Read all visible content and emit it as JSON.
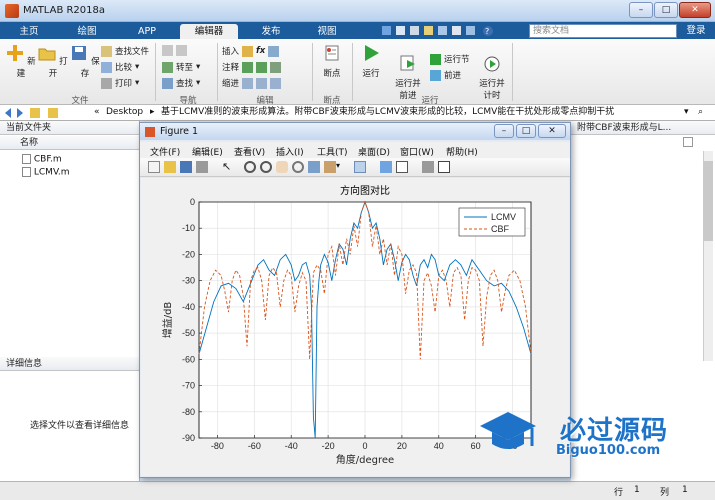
{
  "window": {
    "title": "MATLAB R2018a"
  },
  "tabs": [
    "主页",
    "绘图",
    "APP",
    "编辑器",
    "发布",
    "视图"
  ],
  "active_tab": "编辑器",
  "search": {
    "placeholder": "搜索文档"
  },
  "login_label": "登录",
  "ribbon": {
    "file": {
      "new": "新建",
      "open": "打开",
      "save": "保存",
      "find_files": "查找文件",
      "compare": "比较",
      "print": "打印",
      "group": "文件"
    },
    "navigate": {
      "goto": "转至",
      "find": "查找",
      "group": "导航"
    },
    "edit": {
      "insert": "插入",
      "comment": "注释",
      "indent": "缩进",
      "group": "编辑"
    },
    "breakpoints": {
      "label": "断点",
      "group": "断点"
    },
    "run": {
      "run": "运行",
      "run_advance": "运行并\n前进",
      "run_section": "运行节",
      "advance": "前进",
      "run_time": "运行并\n计时",
      "group": "运行"
    }
  },
  "address": {
    "path_prefix": "«",
    "path1": "Desktop",
    "path2": "基于LCMV准则的波束形成算法。附带CBF波束形成与LCMV波束形成的比较，LCMV能在干扰处形成零点抑制干扰"
  },
  "left_panel": {
    "title": "当前文件夹",
    "col_header": "名称",
    "files": [
      "CBF.m",
      "LCMV.m"
    ],
    "details_title": "详细信息",
    "details_hint": "选择文件以查看详细信息"
  },
  "right_panel": {
    "title": "附带CBF波束形成与L..."
  },
  "status": {
    "row_label": "行",
    "row": "1",
    "col_label": "列",
    "col": "1"
  },
  "figure": {
    "title": "Figure 1",
    "menu": [
      "文件(F)",
      "编辑(E)",
      "查看(V)",
      "插入(I)",
      "工具(T)",
      "桌面(D)",
      "窗口(W)",
      "帮助(H)"
    ]
  },
  "watermark": {
    "brand": "必过源码",
    "url": "Biguo100.com"
  },
  "chart_data": {
    "type": "line",
    "title": "方向图对比",
    "xlabel": "角度/degree",
    "ylabel": "增益/dB",
    "xlim": [
      -90,
      90
    ],
    "ylim": [
      -90,
      0
    ],
    "xticks": [
      -80,
      -60,
      -40,
      -20,
      0,
      20,
      40,
      60,
      80
    ],
    "yticks": [
      0,
      -10,
      -20,
      -30,
      -40,
      -50,
      -60,
      -70,
      -80,
      -90
    ],
    "grid": true,
    "legend_position": "top-right",
    "series": [
      {
        "name": "LCMV",
        "color": "#0072bd",
        "style": "solid",
        "x": [
          -90,
          -86,
          -82,
          -78,
          -74,
          -70,
          -66,
          -62,
          -58,
          -55,
          -52,
          -49,
          -46,
          -43,
          -40,
          -38,
          -36,
          -34,
          -32,
          -30,
          -29,
          -28,
          -27,
          -26,
          -25,
          -24,
          -22,
          -20,
          -18,
          -16,
          -14,
          -12,
          -10,
          -8,
          -6,
          -4,
          -2,
          0,
          2,
          4,
          6,
          8,
          10,
          12,
          14,
          16,
          18,
          20,
          22,
          24,
          26,
          28,
          30,
          32,
          34,
          36,
          38,
          40,
          43,
          46,
          49,
          52,
          55,
          58,
          62,
          66,
          70,
          74,
          78,
          82,
          86,
          90
        ],
        "y": [
          -58,
          -48,
          -38,
          -32,
          -31,
          -33,
          -38,
          -31,
          -24,
          -22,
          -26,
          -28,
          -22,
          -20,
          -24,
          -30,
          -28,
          -24,
          -23,
          -28,
          -40,
          -82,
          -90,
          -40,
          -30,
          -24,
          -20,
          -23,
          -30,
          -22,
          -16,
          -18,
          -24,
          -14,
          -8,
          -10,
          -4,
          0,
          -4,
          -10,
          -8,
          -14,
          -24,
          -18,
          -16,
          -22,
          -30,
          -23,
          -20,
          -22,
          -28,
          -32,
          -24,
          -22,
          -25,
          -20,
          -22,
          -28,
          -30,
          -24,
          -22,
          -24,
          -28,
          -22,
          -26,
          -30,
          -32,
          -31,
          -34,
          -40,
          -48,
          -58
        ]
      },
      {
        "name": "CBF",
        "color": "#d95319",
        "style": "dashed",
        "x": [
          -90,
          -87,
          -84,
          -81,
          -78,
          -76,
          -74,
          -72,
          -70,
          -68,
          -66,
          -64,
          -62,
          -60,
          -58,
          -56,
          -54,
          -52,
          -50,
          -48,
          -46,
          -44,
          -42,
          -40,
          -38,
          -36,
          -34,
          -32,
          -30,
          -28,
          -26,
          -24,
          -22,
          -20,
          -18,
          -16,
          -14,
          -12,
          -10,
          -8,
          -6,
          -4,
          -2,
          0,
          2,
          4,
          6,
          8,
          10,
          12,
          14,
          16,
          18,
          20,
          22,
          24,
          26,
          28,
          30,
          32,
          34,
          36,
          38,
          40,
          42,
          44,
          46,
          48,
          50,
          52,
          54,
          56,
          58,
          60,
          62,
          64,
          66,
          68,
          70,
          72,
          74,
          76,
          78,
          81,
          84,
          87,
          90
        ],
        "y": [
          -58,
          -40,
          -30,
          -26,
          -28,
          -34,
          -42,
          -30,
          -26,
          -28,
          -36,
          -55,
          -30,
          -26,
          -25,
          -30,
          -45,
          -28,
          -25,
          -27,
          -40,
          -30,
          -26,
          -28,
          -42,
          -32,
          -27,
          -30,
          -60,
          -27,
          -24,
          -26,
          -35,
          -20,
          -17,
          -28,
          -16,
          -24,
          -14,
          -20,
          -9,
          -17,
          -4,
          0,
          -4,
          -17,
          -9,
          -20,
          -14,
          -24,
          -16,
          -28,
          -17,
          -20,
          -35,
          -26,
          -24,
          -27,
          -60,
          -30,
          -27,
          -32,
          -42,
          -28,
          -26,
          -30,
          -40,
          -27,
          -25,
          -28,
          -45,
          -30,
          -25,
          -26,
          -30,
          -55,
          -36,
          -28,
          -26,
          -30,
          -42,
          -34,
          -28,
          -26,
          -30,
          -40,
          -58
        ]
      }
    ]
  }
}
